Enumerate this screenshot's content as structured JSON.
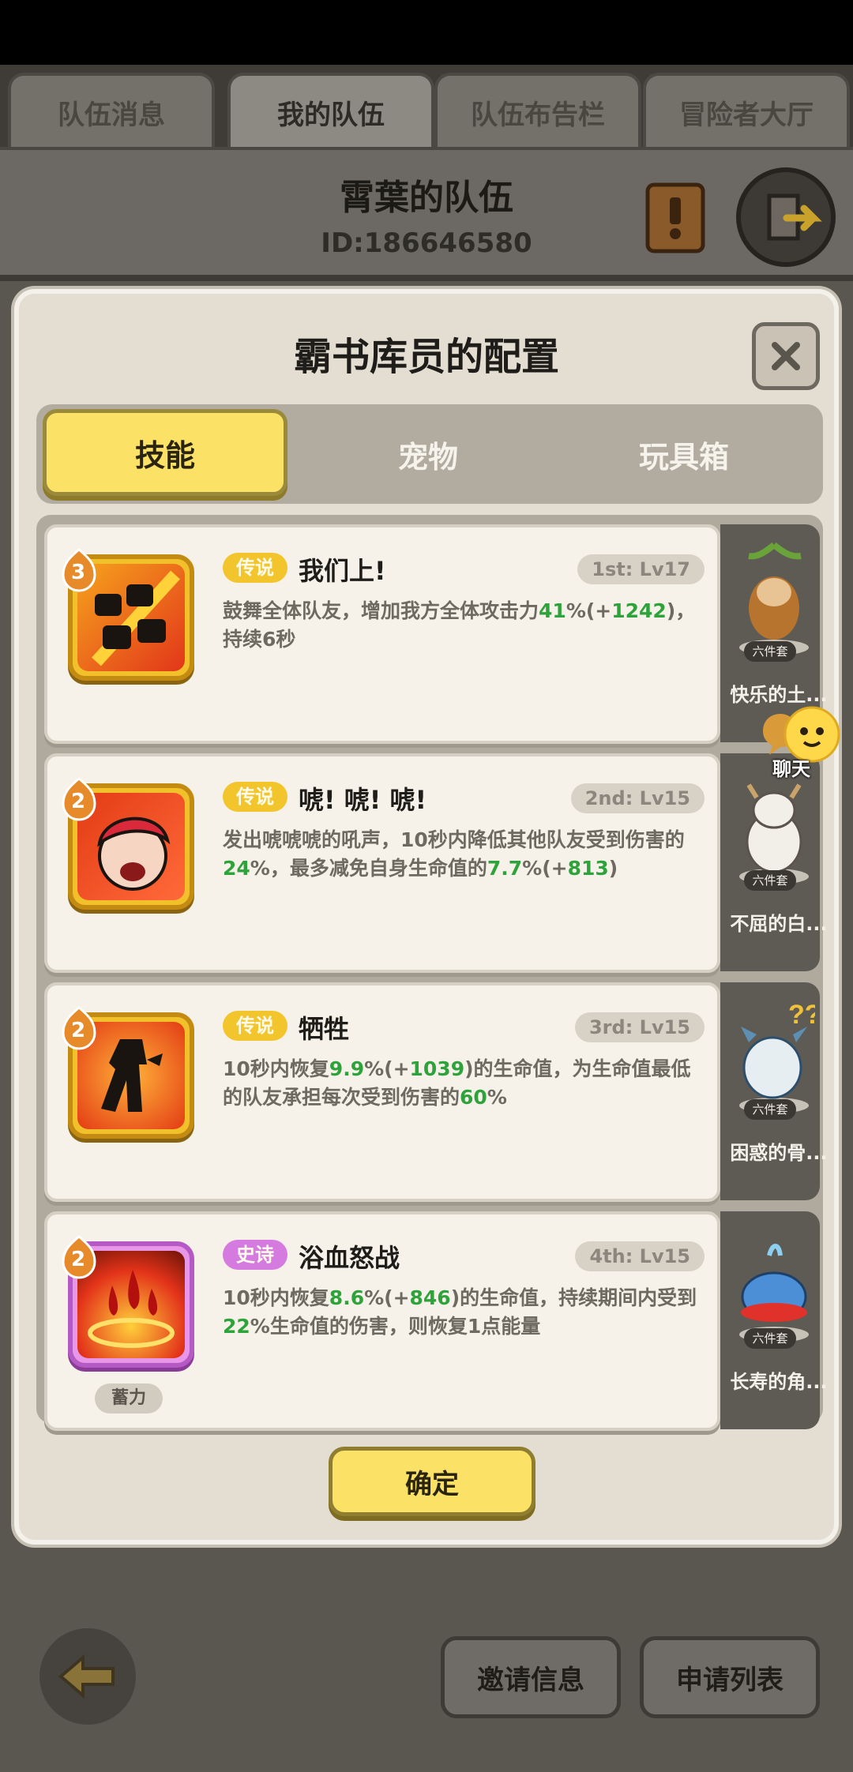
{
  "top_tabs": [
    "队伍消息",
    "我的队伍",
    "队伍布告栏",
    "冒险者大厅"
  ],
  "team": {
    "name": "霄葉的队伍",
    "id": "ID:186646580"
  },
  "modal": {
    "title": "霸书库员的配置",
    "tabs": [
      "技能",
      "宠物",
      "玩具箱"
    ],
    "confirm": "确定"
  },
  "skills": [
    {
      "badge": "3",
      "rarity": "传说",
      "name": "我们上!",
      "slot": "1st: Lv17",
      "desc": [
        "鼓舞全体队友，增加我方全体攻击力",
        "41",
        "%(+",
        "1242",
        ")，持续6秒"
      ],
      "pet": {
        "set": "六件套",
        "name": "快乐的土..."
      }
    },
    {
      "badge": "2",
      "rarity": "传说",
      "name": "唬! 唬! 唬!",
      "slot": "2nd: Lv15",
      "desc": [
        "发出唬唬唬的吼声，10秒内降低其他队友受到伤害的",
        "24",
        "%，最多减免自身生命值的",
        "7.7",
        "%(+",
        "813",
        ")"
      ],
      "pet": {
        "set": "六件套",
        "name": "不屈的白..."
      }
    },
    {
      "badge": "2",
      "rarity": "传说",
      "name": "牺牲",
      "slot": "3rd: Lv15",
      "desc": [
        "10秒内恢复",
        "9.9",
        "%(+",
        "1039",
        ")的生命值，为生命值最低的队友承担每次受到伤害的",
        "60",
        "%"
      ],
      "pet": {
        "set": "六件套",
        "name": "困惑的骨..."
      }
    },
    {
      "badge": "2",
      "rarity": "史诗",
      "name": "浴血怒战",
      "slot": "4th: Lv15",
      "charge": "蓄力",
      "desc": [
        "10秒内恢复",
        "8.6",
        "%(+",
        "846",
        ")的生命值，持续期间内受到",
        "22",
        "%生命值的伤害，则恢复1点能量"
      ],
      "pet": {
        "set": "六件套",
        "name": "长寿的角..."
      }
    }
  ],
  "chat": {
    "label": "聊天"
  },
  "bottom": {
    "invite": "邀请信息",
    "applications": "申请列表"
  },
  "colors": {
    "legend": "#f3c52c",
    "epic": "#d57be0",
    "highlight": "#2fa33b",
    "confirm": "#fbe165"
  }
}
